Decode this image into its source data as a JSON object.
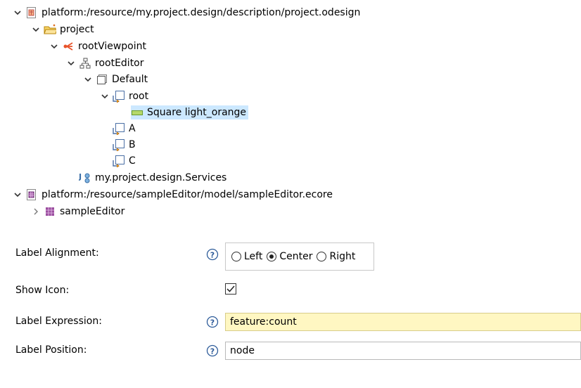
{
  "tree": {
    "items": [
      {
        "label": "platform:/resource/my.project.design/description/project.odesign",
        "icon": "odesign-file-icon"
      },
      {
        "label": "project",
        "icon": "project-folder-icon"
      },
      {
        "label": "rootViewpoint",
        "icon": "viewpoint-icon"
      },
      {
        "label": "rootEditor",
        "icon": "diagram-editor-icon"
      },
      {
        "label": "Default",
        "icon": "layer-icon"
      },
      {
        "label": "root",
        "icon": "node-mapping-icon"
      },
      {
        "label": "Square light_orange",
        "icon": "square-style-icon"
      },
      {
        "label": "A",
        "icon": "node-mapping-icon"
      },
      {
        "label": "B",
        "icon": "node-mapping-icon"
      },
      {
        "label": "C",
        "icon": "node-mapping-icon"
      },
      {
        "label": "my.project.design.Services",
        "icon": "java-extension-icon"
      },
      {
        "label": "platform:/resource/sampleEditor/model/sampleEditor.ecore",
        "icon": "ecore-file-icon"
      },
      {
        "label": "sampleEditor",
        "icon": "epackage-icon"
      }
    ],
    "selected": "Square light_orange"
  },
  "properties": {
    "label_alignment": {
      "label": "Label Alignment:",
      "options": [
        "Left",
        "Center",
        "Right"
      ],
      "selected": "Center"
    },
    "show_icon": {
      "label": "Show Icon:",
      "checked": true
    },
    "label_expression": {
      "label": "Label Expression:",
      "value": "feature:count"
    },
    "label_position": {
      "label": "Label Position:",
      "value": "node"
    }
  }
}
